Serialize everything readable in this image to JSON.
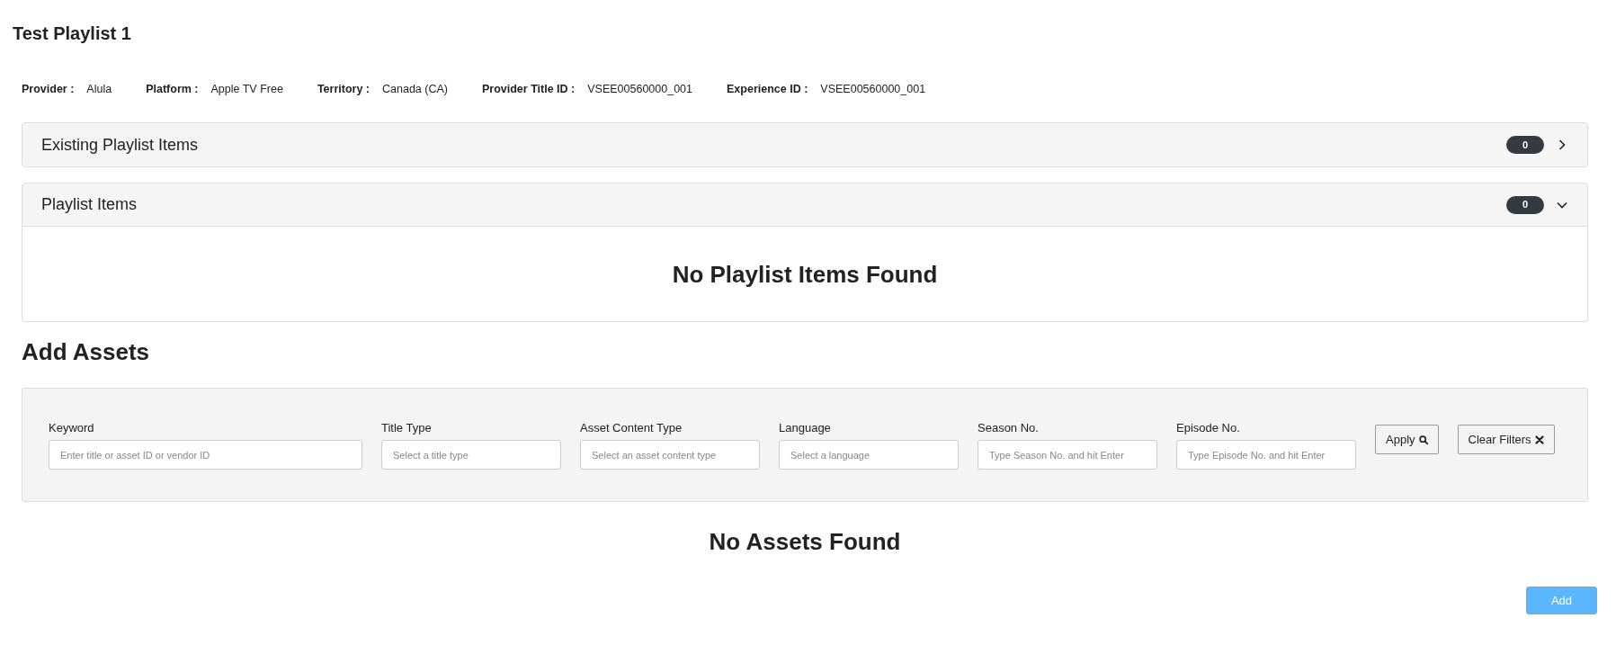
{
  "page_title": "Test Playlist 1",
  "details": [
    {
      "label": "Provider :",
      "value": "Alula"
    },
    {
      "label": "Platform :",
      "value": "Apple TV Free"
    },
    {
      "label": "Territory :",
      "value": "Canada (CA)"
    },
    {
      "label": "Provider Title ID :",
      "value": "VSEE00560000_001"
    },
    {
      "label": "Experience ID :",
      "value": "VSEE00560000_001"
    }
  ],
  "sections": [
    {
      "title": "Existing Playlist Items",
      "count": "0",
      "expanded": false
    },
    {
      "title": "Playlist Items",
      "count": "0",
      "expanded": true,
      "empty_message": "No Playlist Items Found"
    }
  ],
  "add_assets": {
    "heading": "Add Assets",
    "filters": [
      {
        "label": "Keyword",
        "placeholder": "Enter title or asset ID or vendor ID"
      },
      {
        "label": "Title Type",
        "placeholder": "Select a title type"
      },
      {
        "label": "Asset Content Type",
        "placeholder": "Select an asset content type"
      },
      {
        "label": "Language",
        "placeholder": "Select a language"
      },
      {
        "label": "Season No.",
        "placeholder": "Type Season No. and hit Enter"
      },
      {
        "label": "Episode No.",
        "placeholder": "Type Episode No. and hit Enter"
      }
    ],
    "buttons": [
      {
        "kind": "apply",
        "label": "Apply"
      },
      {
        "kind": "clear",
        "label": "Clear Filters"
      }
    ],
    "empty_message": "No Assets Found",
    "add_button": {
      "label": "Add",
      "disabled": true
    }
  }
}
